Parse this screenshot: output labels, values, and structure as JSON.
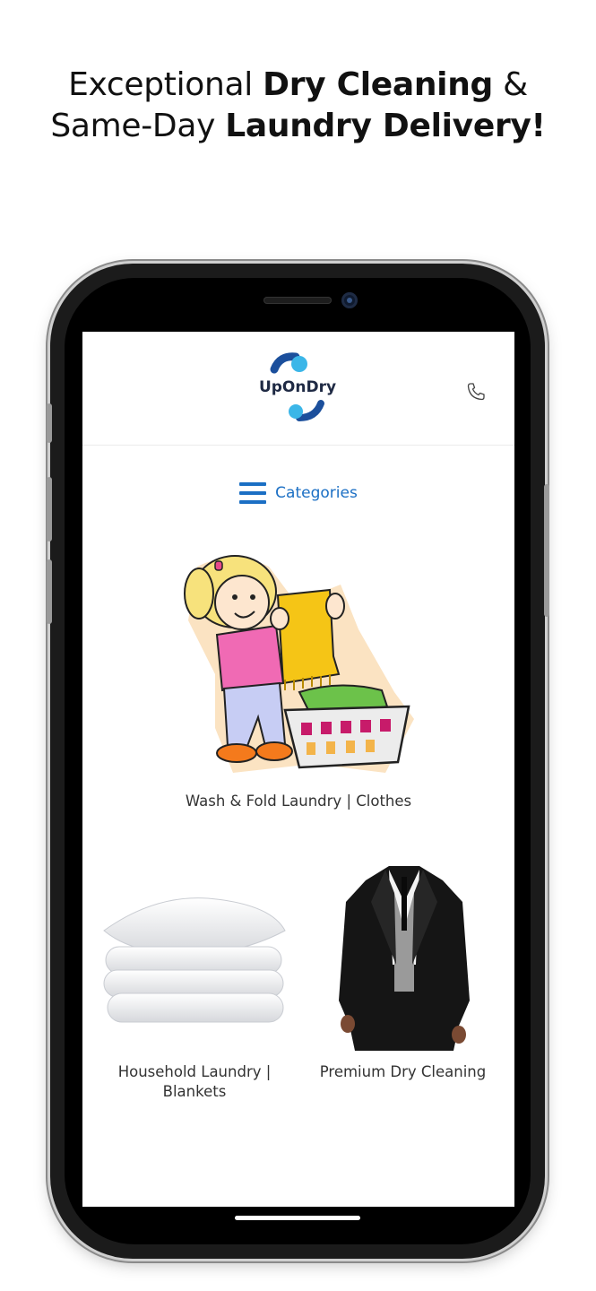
{
  "headline": {
    "line1_pre": "Exceptional ",
    "line1_bold": "Dry Cleaning",
    "line1_post": " &",
    "line2_pre": "Same-Day ",
    "line2_bold": "Laundry Delivery!"
  },
  "app": {
    "logo_text": "UpOnDry",
    "brand_colors": {
      "dark_blue": "#1b4f9c",
      "light_blue": "#3bb6e8",
      "text": "#1f2a44"
    },
    "phone_icon": "phone-icon",
    "categories_label": "Categories",
    "accent": "#1b6fc4"
  },
  "cards": [
    {
      "label": "Wash & Fold Laundry | Clothes",
      "image": "girl-folding-laundry-illustration"
    },
    {
      "label": "Household Laundry | Blankets",
      "image": "pillow-and-blanket-photo"
    },
    {
      "label": "Premium Dry Cleaning",
      "image": "suit-photo"
    }
  ]
}
